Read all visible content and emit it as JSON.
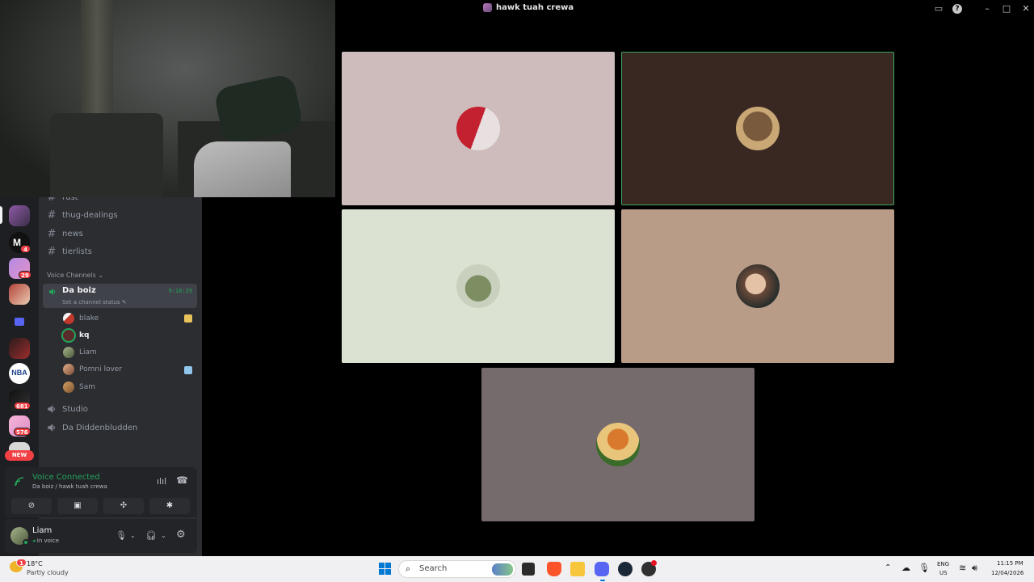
{
  "window": {
    "title": "hawk tuah crewa"
  },
  "channels": [
    {
      "name": "rust",
      "type": "text"
    },
    {
      "name": "thug-dealings",
      "type": "text"
    },
    {
      "name": "news",
      "type": "text"
    },
    {
      "name": "tierlists",
      "type": "text"
    }
  ],
  "voice": {
    "category": "Voice Channels",
    "active_channel": {
      "name": "Da boiz",
      "timer": "9:18:29",
      "status_hint": "Set a channel status"
    },
    "members": [
      {
        "name": "blake",
        "color": "#c0392b"
      },
      {
        "name": "kq",
        "color": "#5a2b2b"
      },
      {
        "name": "Liam",
        "color": "#7a8a6a"
      },
      {
        "name": "Pomni lover",
        "color": "#c6885f"
      },
      {
        "name": "Sam",
        "color": "#b07a45"
      }
    ],
    "other_channels": [
      {
        "name": "Studio"
      },
      {
        "name": "Da Diddenbludden"
      }
    ]
  },
  "server_badges": [
    "4",
    "29",
    "681",
    "576"
  ],
  "new_badge": "NEW",
  "voice_panel": {
    "status": "Voice Connected",
    "location": "Da boiz / hawk tuah crewa"
  },
  "user_panel": {
    "name": "Liam",
    "status": "In voice"
  },
  "video_tiles": [
    {
      "bg": "#cdbcbb",
      "avatar": "#c42130",
      "speaking": false
    },
    {
      "bg": "#392822",
      "avatar": "#7a5a3c",
      "speaking": true
    },
    {
      "bg": "#dbe2d2",
      "avatar": "#7d8f62",
      "speaking": false
    },
    {
      "bg": "#b89c87",
      "avatar": "#6b4a3a",
      "speaking": false
    },
    {
      "bg": "#766b6c",
      "avatar": "#d9792d",
      "speaking": false
    }
  ],
  "taskbar": {
    "weather_temp": "18°C",
    "weather_desc": "Partly cloudy",
    "weather_badge": "1",
    "search_label": "Search",
    "lang_top": "ENG",
    "lang_bottom": "US",
    "time": "11:15 PM",
    "date": "12/04/2026"
  },
  "colors": {
    "accent_green": "#23a55a",
    "speaking_border": "#3ba55c",
    "badge_red": "#f23f43"
  }
}
